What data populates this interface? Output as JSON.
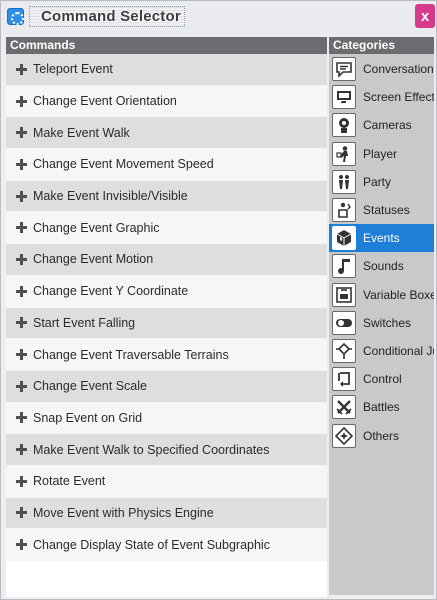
{
  "window": {
    "title": "Command Selector",
    "close_glyph": "x"
  },
  "commands": {
    "header": "Commands",
    "items": [
      "Teleport Event",
      "Change Event Orientation",
      "Make Event Walk",
      "Change Event Movement Speed",
      "Make Event Invisible/Visible",
      "Change Event Graphic",
      "Change Event Motion",
      "Change Event Y Coordinate",
      "Start Event Falling",
      "Change Event Traversable Terrains",
      "Change Event Scale",
      "Snap Event on Grid",
      "Make Event Walk to Specified Coordinates",
      "Rotate Event",
      "Move Event with Physics Engine",
      "Change Display State of Event Subgraphic"
    ]
  },
  "categories": {
    "header": "Categories",
    "selected_color": "#1e7fd8",
    "items": [
      {
        "label": "Conversation",
        "icon": "speech-bubble-icon"
      },
      {
        "label": "Screen Effects",
        "icon": "monitor-icon"
      },
      {
        "label": "Cameras",
        "icon": "camera-icon"
      },
      {
        "label": "Player",
        "icon": "player-icon"
      },
      {
        "label": "Party",
        "icon": "party-icon"
      },
      {
        "label": "Statuses",
        "icon": "statuses-icon"
      },
      {
        "label": "Events",
        "icon": "cube-icon",
        "selected": true
      },
      {
        "label": "Sounds",
        "icon": "music-note-icon"
      },
      {
        "label": "Variable Boxes",
        "icon": "variable-box-icon"
      },
      {
        "label": "Switches",
        "icon": "toggle-switch-icon"
      },
      {
        "label": "Conditional Jumps",
        "icon": "conditional-arrows-icon"
      },
      {
        "label": "Control",
        "icon": "loop-icon"
      },
      {
        "label": "Battles",
        "icon": "crossed-swords-icon"
      },
      {
        "label": "Others",
        "icon": "star-diamond-icon"
      }
    ]
  }
}
